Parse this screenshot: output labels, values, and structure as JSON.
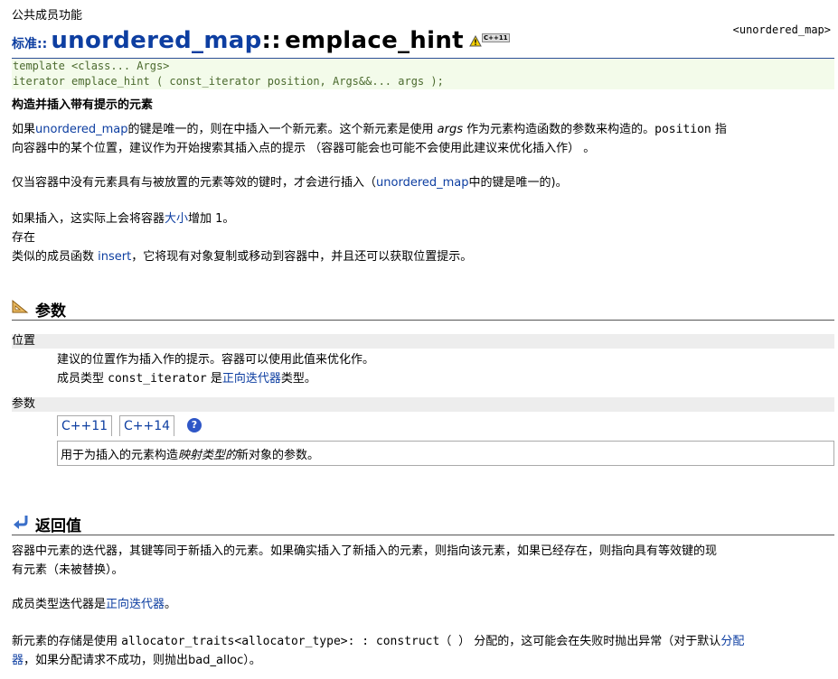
{
  "header": {
    "section_label": "公共成员功能",
    "std_prefix": "标准::",
    "class_name": "unordered_map",
    "scope_sep": "::",
    "func_name": "emplace_hint",
    "version_badge": "C++11",
    "header_ref": "<unordered_map>"
  },
  "code": {
    "line1": "template <class... Args>",
    "line2": "iterator emplace_hint ( const_iterator position, Args&&... args );"
  },
  "summary": "构造并插入带有提示的元素",
  "desc": {
    "p1_a": "如果",
    "p1_link1": "unordered_map",
    "p1_b": "的键是唯一的，则在中插入一个新元素。这个新元素是使用 ",
    "p1_args": "args",
    "p1_c": " 作为元素构造函数的参数来构造的。",
    "p1_position": "position",
    "p1_d": " 指",
    "p1_line2": "向容器中的某个位置，建议作为开始搜索其插入点的提示 （容器可能会也可能不会使用此建议来优化插入作） 。",
    "p2_a": "仅当容器中没有元素具有与被放置的元素等效的键时，才会进行插入（",
    "p2_link": "unordered_map",
    "p2_b": "中的键是唯一的)。",
    "p3_a": "如果插入，这实际上会将容器",
    "p3_link": "大小",
    "p3_b": "增加 1。",
    "p4": "存在",
    "p5_a": "类似的成员函数 ",
    "p5_link": "insert",
    "p5_b": "，它将现有对象复制或移动到容器中，并且还可以获取位置提示。"
  },
  "params_section": {
    "title": "参数",
    "param1_name": "位置",
    "param1_desc1": "建议的位置作为插入作的提示。容器可以使用此值来优化作。",
    "param1_desc2_a": "成员类型 ",
    "param1_desc2_code": "const_iterator",
    "param1_desc2_b": " 是",
    "param1_desc2_link": "正向迭代器",
    "param1_desc2_c": "类型。",
    "param2_name": "参数",
    "tabs": [
      "C++11",
      "C++14"
    ],
    "help_glyph": "?",
    "panel_a": "用于为插入的元素构造",
    "panel_italic": "映射类型的",
    "panel_b": "新对象的参数。"
  },
  "return_section": {
    "title": "返回值",
    "r1_line1": "容器中元素的迭代器，其键等同于新插入的元素。如果确实插入了新插入的元素，则指向该元素，如果已经存在，则指向具有等效键的现",
    "r1_line2": "有元素（未被替换）。",
    "r2_a": "成员类型迭代器是",
    "r2_link": "正向迭代器",
    "r2_b": "。",
    "r3_a": "新元素的存储是使用 ",
    "r3_code": "allocator_traits<allocator_type>: : construct（ ）",
    "r3_b": " 分配的，这可能会在失败时抛出异常（对于默认",
    "r3_link": "分配",
    "r3_line2_link": "器",
    "r3_line2_b": "，如果分配请求不成功，则抛出bad_alloc）。"
  },
  "colors": {
    "link": "#0d3ea1",
    "code_bg": "#f3fbea",
    "code_text": "#4b6a2e",
    "param_bar": "#ededed",
    "help_icon": "#2f57c7"
  }
}
